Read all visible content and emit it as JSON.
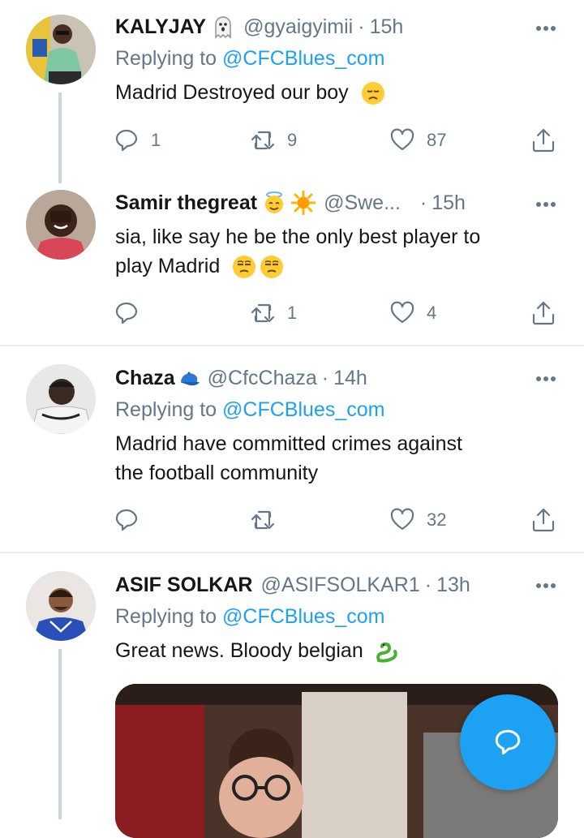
{
  "tweets": [
    {
      "name": "KALYJAY",
      "handle": "@gyaigyimii",
      "time": "15h",
      "replying_label": "Replying to",
      "replying_to": "@CFCBlues_com",
      "text": "Madrid Destroyed our boy",
      "replies": "1",
      "retweets": "9",
      "likes": "87"
    },
    {
      "name": "Samir thegreat",
      "handle": "@Swe...",
      "time": "15h",
      "text_line1": "sia, like say he be the only best player to",
      "text_line2": "play Madrid",
      "replies": "",
      "retweets": "1",
      "likes": "4"
    },
    {
      "name": "Chaza",
      "handle": "@CfcChaza",
      "time": "14h",
      "replying_label": "Replying to",
      "replying_to": "@CFCBlues_com",
      "text_line1": "Madrid have committed crimes against",
      "text_line2": "the football community",
      "replies": "",
      "retweets": "",
      "likes": "32"
    },
    {
      "name": "ASIF SOLKAR",
      "handle": "@ASIFSOLKAR1",
      "time": "13h",
      "replying_label": "Replying to",
      "replying_to": "@CFCBlues_com",
      "text": "Great news. Bloody belgian"
    }
  ],
  "icons": {
    "reply": "reply-icon",
    "retweet": "retweet-icon",
    "like": "heart-icon",
    "share": "share-icon",
    "more": "more-icon",
    "compose": "compose-reply-icon"
  },
  "colors": {
    "accent": "#1da1f2",
    "secondary_text": "#657786",
    "separator": "#e6ecf0",
    "thread_line": "#ccd6dd"
  }
}
